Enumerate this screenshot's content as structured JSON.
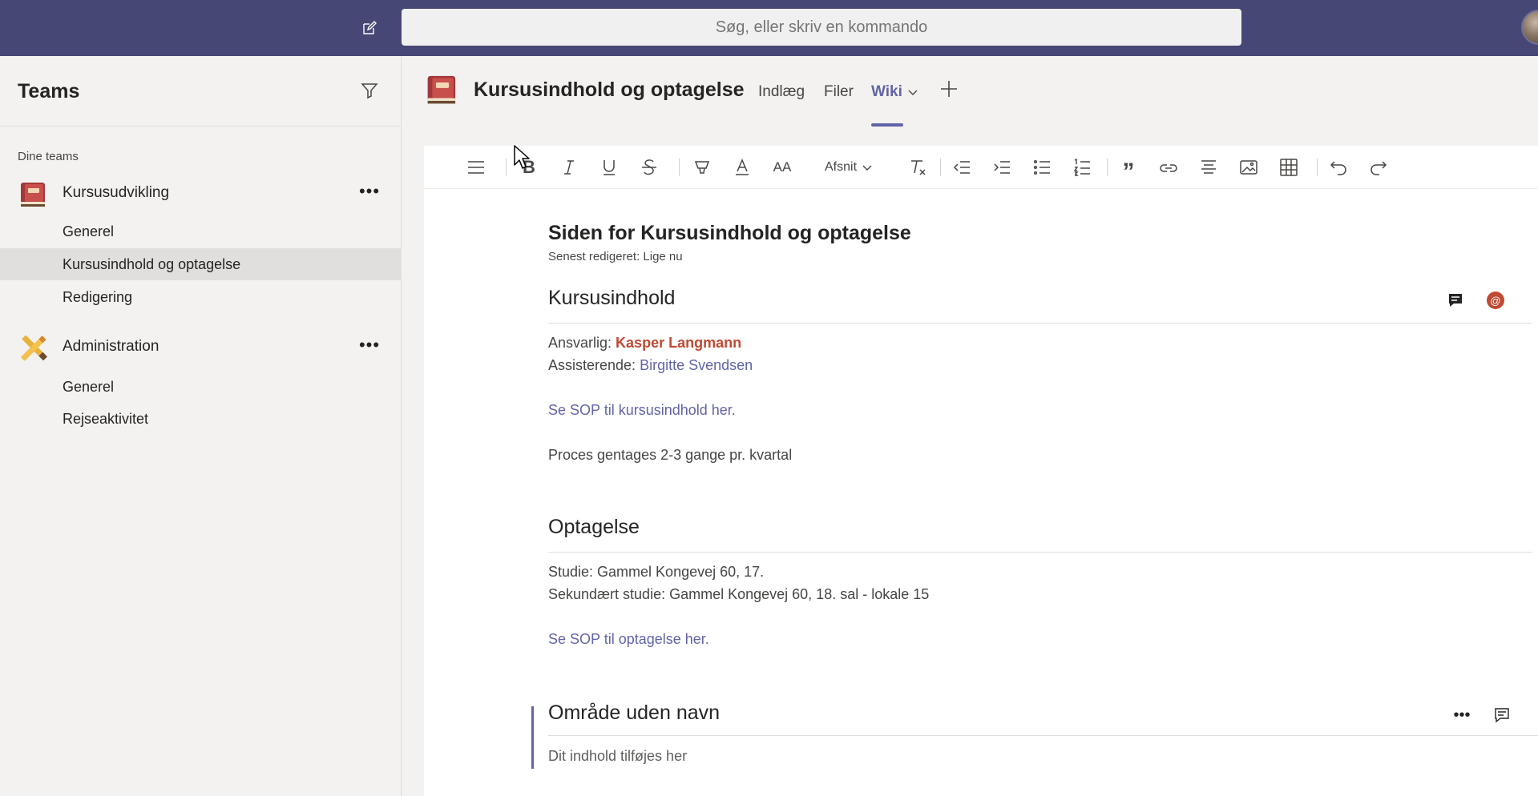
{
  "topbar": {
    "search_placeholder": "Søg, eller skriv en kommando",
    "compose_icon": "compose-icon",
    "bg_color": "#464775"
  },
  "leftpanel": {
    "title": "Teams",
    "section_label": "Dine teams",
    "teams": [
      {
        "name": "Kursusudvikling",
        "icon": "book-icon",
        "channels": [
          "Generel",
          "Kursusindhold og optagelse",
          "Redigering"
        ]
      },
      {
        "name": "Administration",
        "icon": "pencil-ruler-icon",
        "channels": [
          "Generel",
          "Rejseaktivitet"
        ]
      }
    ],
    "active_channel": "Kursusindhold og optagelse"
  },
  "channel_header": {
    "title": "Kursusindhold og optagelse",
    "tabs": [
      "Indlæg",
      "Filer",
      "Wiki"
    ],
    "active_tab": "Wiki",
    "accent_color": "#6264a7"
  },
  "toolbar": {
    "paragraph_dropdown": "Afsnit",
    "bold_label": "B",
    "font_size_label": "AA"
  },
  "wiki": {
    "page_title": "Siden for Kursusindhold og optagelse",
    "last_edited": "Senest redigeret: Lige nu",
    "sections": [
      {
        "heading": "Kursusindhold",
        "responsible_label": "Ansvarlig:",
        "responsible_name": "Kasper Langmann",
        "assistant_label": "Assisterende:",
        "assistant_name": "Birgitte Svendsen",
        "link": "Se SOP til kursusindhold her.",
        "note": "Proces gentages 2-3 gange pr. kvartal",
        "mention_badge": "@"
      },
      {
        "heading": "Optagelse",
        "line1": "Studie: Gammel Kongevej 60, 17.",
        "line2": "Sekundært studie: Gammel Kongevej 60, 18. sal - lokale 15",
        "link": "Se SOP til optagelse her."
      },
      {
        "heading": "Område uden navn",
        "placeholder": "Dit indhold tilføjes her"
      }
    ]
  }
}
